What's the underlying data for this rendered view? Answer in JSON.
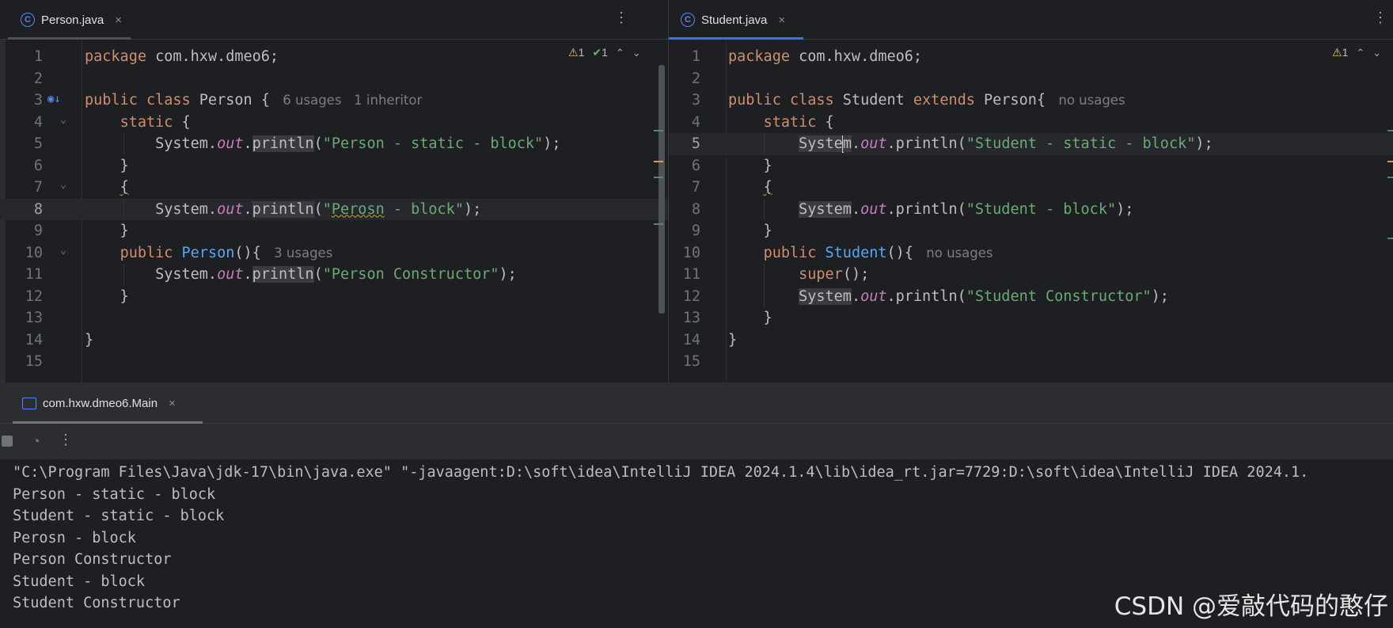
{
  "left_editor": {
    "tab": {
      "icon": "class-icon",
      "icon_glyph": "C",
      "label": "Person.java",
      "close": "×"
    },
    "kebab": "⋮",
    "inspections": {
      "warn_icon": "warning-icon",
      "warn_glyph": "⚠",
      "warn_count": "1",
      "ok_icon": "check-icon",
      "ok_glyph": "✔",
      "ok_count": "1",
      "up": "⌃",
      "down": "⌄"
    },
    "lines": [
      {
        "num": "1",
        "segs": [
          [
            "kw",
            "package "
          ],
          [
            "",
            "com.hxw.dmeo6;"
          ]
        ]
      },
      {
        "num": "2",
        "segs": []
      },
      {
        "num": "3",
        "segs": [
          [
            "kw",
            "public class "
          ],
          [
            "",
            "Person { "
          ],
          [
            "hint",
            " 6 usages   1 inheritor"
          ]
        ]
      },
      {
        "num": "4",
        "segs": [
          [
            "",
            "    "
          ],
          [
            "kw",
            "static"
          ],
          [
            "",
            " {"
          ]
        ]
      },
      {
        "num": "5",
        "segs": [
          [
            "",
            "        System."
          ],
          [
            "fld",
            "out"
          ],
          [
            "",
            "."
          ],
          [
            "hl",
            "println"
          ],
          [
            "",
            "("
          ],
          [
            "str",
            "\"Person - static - block\""
          ],
          [
            "",
            ");"
          ]
        ]
      },
      {
        "num": "6",
        "segs": [
          [
            "",
            "    }"
          ]
        ]
      },
      {
        "num": "7",
        "segs": [
          [
            "",
            "    "
          ],
          [
            "squig",
            "{"
          ]
        ]
      },
      {
        "num": "8",
        "segs": [
          [
            "",
            "        System."
          ],
          [
            "fld",
            "out"
          ],
          [
            "",
            "."
          ],
          [
            "hl",
            "println"
          ],
          [
            "",
            "("
          ],
          [
            "str",
            "\""
          ],
          [
            "str squig",
            "Perosn"
          ],
          [
            "str",
            " - block\""
          ],
          [
            "",
            ");"
          ]
        ]
      },
      {
        "num": "9",
        "segs": [
          [
            "",
            "    }"
          ]
        ]
      },
      {
        "num": "10",
        "segs": [
          [
            "",
            "    "
          ],
          [
            "kw",
            "public "
          ],
          [
            "fn",
            "Person"
          ],
          [
            "",
            "(){ "
          ],
          [
            "hint",
            " 3 usages"
          ]
        ]
      },
      {
        "num": "11",
        "segs": [
          [
            "",
            "        System."
          ],
          [
            "fld",
            "out"
          ],
          [
            "",
            "."
          ],
          [
            "hl",
            "println"
          ],
          [
            "",
            "("
          ],
          [
            "str",
            "\"Person Constructor\""
          ],
          [
            "",
            ");"
          ]
        ]
      },
      {
        "num": "12",
        "segs": [
          [
            "",
            "    }"
          ]
        ]
      },
      {
        "num": "13",
        "segs": []
      },
      {
        "num": "14",
        "segs": [
          [
            "",
            "}"
          ]
        ]
      },
      {
        "num": "15",
        "segs": []
      }
    ],
    "current_line": "8",
    "gutter_icon": "override-marker-icon"
  },
  "right_editor": {
    "tab": {
      "icon": "class-icon",
      "icon_glyph": "C",
      "label": "Student.java",
      "close": "×"
    },
    "kebab": "⋮",
    "inspections": {
      "warn_icon": "warning-icon",
      "warn_glyph": "⚠",
      "warn_count": "1",
      "up": "⌃",
      "down": "⌄"
    },
    "lines": [
      {
        "num": "1",
        "segs": [
          [
            "kw",
            "package "
          ],
          [
            "",
            "com.hxw.dmeo6;"
          ]
        ]
      },
      {
        "num": "2",
        "segs": []
      },
      {
        "num": "3",
        "segs": [
          [
            "kw",
            "public class "
          ],
          [
            "",
            "Student "
          ],
          [
            "kw",
            "extends "
          ],
          [
            "",
            "Person{ "
          ],
          [
            "hint",
            " no usages"
          ]
        ]
      },
      {
        "num": "4",
        "segs": [
          [
            "",
            "    "
          ],
          [
            "kw",
            "static"
          ],
          [
            "",
            " {"
          ]
        ]
      },
      {
        "num": "5",
        "segs": [
          [
            "",
            "        "
          ],
          [
            "hl",
            "Syste"
          ],
          [
            "caret",
            ""
          ],
          [
            "hl",
            "m"
          ],
          [
            "",
            "."
          ],
          [
            "fld",
            "out"
          ],
          [
            "",
            ".println("
          ],
          [
            "str",
            "\"Student - static - block\""
          ],
          [
            "",
            ");"
          ]
        ]
      },
      {
        "num": "6",
        "segs": [
          [
            "",
            "    }"
          ]
        ]
      },
      {
        "num": "7",
        "segs": [
          [
            "",
            "    "
          ],
          [
            "squig",
            "{"
          ]
        ]
      },
      {
        "num": "8",
        "segs": [
          [
            "",
            "        "
          ],
          [
            "hl",
            "System"
          ],
          [
            "",
            "."
          ],
          [
            "fld",
            "out"
          ],
          [
            "",
            ".println("
          ],
          [
            "str",
            "\"Student - block\""
          ],
          [
            "",
            ");"
          ]
        ]
      },
      {
        "num": "9",
        "segs": [
          [
            "",
            "    }"
          ]
        ]
      },
      {
        "num": "10",
        "segs": [
          [
            "",
            "    "
          ],
          [
            "kw",
            "public "
          ],
          [
            "fn",
            "Student"
          ],
          [
            "",
            "(){ "
          ],
          [
            "hint",
            " no usages"
          ]
        ]
      },
      {
        "num": "11",
        "segs": [
          [
            "",
            "        "
          ],
          [
            "kw",
            "super"
          ],
          [
            "",
            "();"
          ]
        ]
      },
      {
        "num": "12",
        "segs": [
          [
            "",
            "        "
          ],
          [
            "hl",
            "System"
          ],
          [
            "",
            "."
          ],
          [
            "fld",
            "out"
          ],
          [
            "",
            ".println("
          ],
          [
            "str",
            "\"Student Constructor\""
          ],
          [
            "",
            ");"
          ]
        ]
      },
      {
        "num": "13",
        "segs": [
          [
            "",
            "    }"
          ]
        ]
      },
      {
        "num": "14",
        "segs": [
          [
            "",
            "}"
          ]
        ]
      },
      {
        "num": "15",
        "segs": []
      }
    ],
    "current_line": "5"
  },
  "run_panel": {
    "tab": {
      "icon": "application-icon",
      "label": "com.hxw.dmeo6.Main",
      "close": "×"
    },
    "toolbar": {
      "stop_icon": "stop-icon",
      "profiler_icon": "gauge-icon",
      "profiler_glyph": "◔",
      "more_icon": "more-icon",
      "more_glyph": "⋮"
    },
    "console_lines": [
      "\"C:\\Program Files\\Java\\jdk-17\\bin\\java.exe\" \"-javaagent:D:\\soft\\idea\\IntelliJ IDEA 2024.1.4\\lib\\idea_rt.jar=7729:D:\\soft\\idea\\IntelliJ IDEA 2024.1.",
      "Person - static - block",
      "Student - static - block",
      "Perosn - block",
      "Person Constructor",
      "Student - block",
      "Student Constructor"
    ]
  },
  "watermark": "CSDN @爱敲代码的憨仔",
  "colors": {
    "keyword": "#cf8e6d",
    "string": "#6aab73",
    "static_field": "#c77dbb",
    "method_decl": "#56a8f5",
    "accent_tab": "#3574f0",
    "background": "#1e1f22"
  }
}
